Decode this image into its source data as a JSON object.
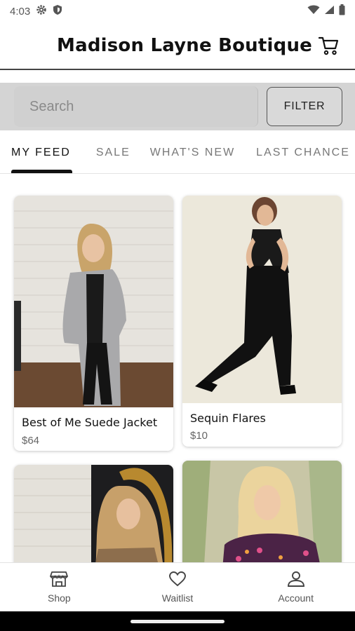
{
  "status_bar": {
    "time": "4:03",
    "icons": [
      "gear-icon",
      "shield-icon",
      "wifi-icon",
      "signal-icon",
      "battery-icon"
    ]
  },
  "header": {
    "title": "Madison Layne Boutique",
    "cart_icon": "cart-icon"
  },
  "search": {
    "placeholder": "Search",
    "filter_label": "FILTER"
  },
  "tabs": [
    {
      "label": "MY FEED",
      "active": true
    },
    {
      "label": "SALE",
      "active": false
    },
    {
      "label": "WHAT'S NEW",
      "active": false
    },
    {
      "label": "LAST CHANCE",
      "active": false
    }
  ],
  "products": [
    {
      "name": "Best of Me Suede Jacket",
      "price": "$64"
    },
    {
      "name": "Sequin Flares",
      "price": "$10"
    },
    {
      "name": "",
      "price": ""
    },
    {
      "name": "",
      "price": ""
    }
  ],
  "bottom_nav": [
    {
      "label": "Shop",
      "icon": "shop-icon"
    },
    {
      "label": "Waitlist",
      "icon": "heart-icon"
    },
    {
      "label": "Account",
      "icon": "person-icon"
    }
  ],
  "colors": {
    "search_band": "#d4d4d4",
    "accent": "#111111",
    "muted_text": "#777777"
  }
}
